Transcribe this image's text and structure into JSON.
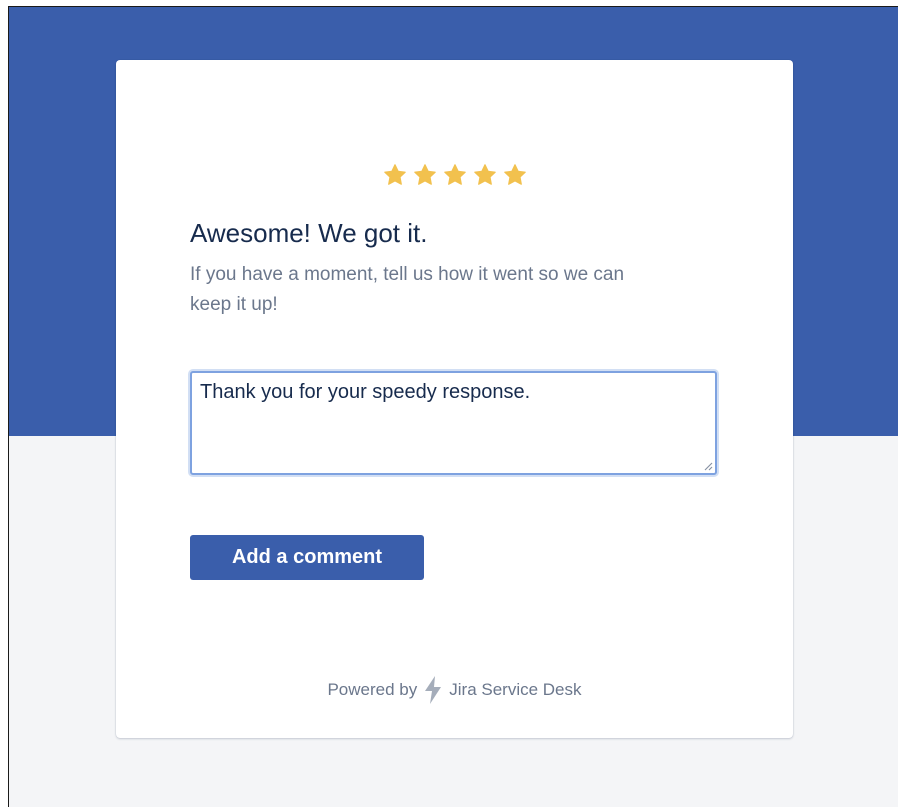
{
  "colors": {
    "banner": "#3a5eab",
    "page_background": "#f4f5f7",
    "card": "#ffffff",
    "star": "#f2c14e",
    "title": "#172b4d",
    "muted_text": "#6b778c",
    "button": "#3a5eab",
    "button_text": "#ffffff",
    "focus_ring": "#7ea2e0",
    "logo": "#a5adba"
  },
  "rating": {
    "stars": 5,
    "max": 5,
    "icon": "star-icon"
  },
  "feedback": {
    "title": "Awesome! We got it.",
    "subtitle": "If you have a moment, tell us how it went so we can keep it up!",
    "comment_value": "Thank you for your speedy response.",
    "button_label": "Add a comment"
  },
  "footer": {
    "powered_by": "Powered by",
    "product_icon": "jira-bolt-icon",
    "product_name": "Jira Service Desk"
  }
}
